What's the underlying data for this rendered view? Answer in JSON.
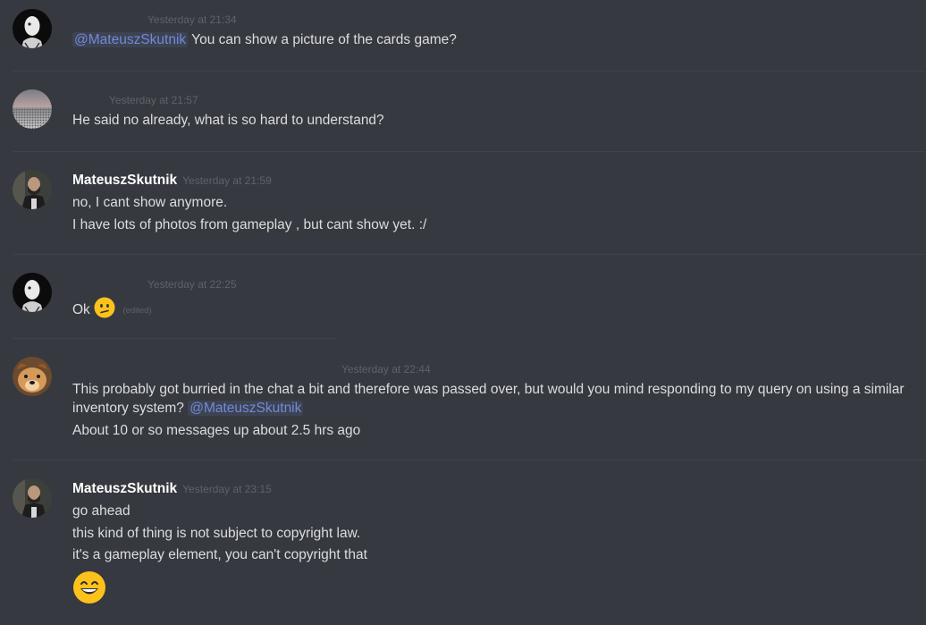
{
  "messages": [
    {
      "username": "",
      "timestamp": "Yesterday at 21:34",
      "avatar": "masked-face-avatar",
      "mention": "@MateuszSkutnik",
      "text": " You can show a picture of the cards game?"
    },
    {
      "username": "",
      "timestamp": "Yesterday at 21:57",
      "avatar": "crowd-landscape-avatar",
      "text": "He said no already, what is so hard to understand?"
    },
    {
      "username": "MateuszSkutnik",
      "timestamp": "Yesterday at 21:59",
      "avatar": "bearded-man-avatar",
      "lines": [
        "no, I cant show anymore.",
        "I have lots of photos from gameplay , but cant show yet. :/"
      ]
    },
    {
      "username": "",
      "timestamp": "Yesterday at 22:25",
      "avatar": "masked-face-avatar",
      "text": "Ok",
      "emoji": "confused-face-emoji",
      "edited": "(edited)"
    },
    {
      "username": "",
      "timestamp": "Yesterday at 22:44",
      "avatar": "dog-avatar",
      "text": "This probably got burried in the chat a bit and therefore was passed over, but would you mind responding to my query on using a similar inventory system?",
      "mention": "@MateuszSkutnik",
      "line2": "About 10 or so messages up about 2.5 hrs ago"
    },
    {
      "username": "MateuszSkutnik",
      "timestamp": "Yesterday at 23:15",
      "avatar": "bearded-man-avatar",
      "lines": [
        "go ahead",
        "this kind of thing is not subject to copyright law.",
        "it's a gameplay element, you can't copyright that"
      ],
      "emoji": "grinning-face-emoji"
    }
  ],
  "colors": {
    "background": "#36393f",
    "text": "#dcddde",
    "username": "#ffffff",
    "timestamp": "#5f6268",
    "mention": "#7289da",
    "emoji": "#fcc21b"
  }
}
